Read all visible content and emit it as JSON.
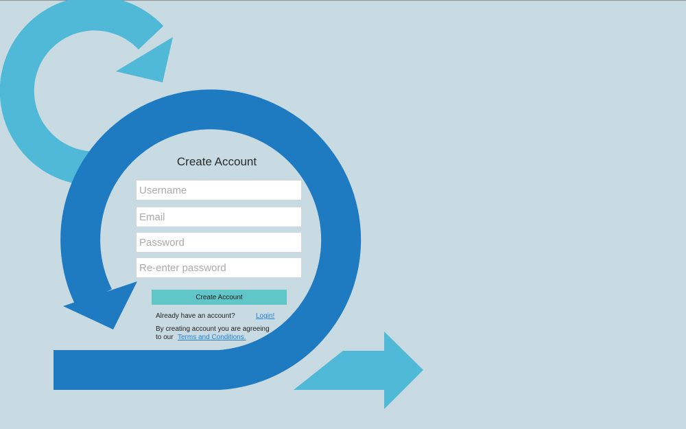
{
  "colors": {
    "background": "#c8dae2",
    "big_loop": "#1f7bc1",
    "accent_arrows": "#4fb9d7",
    "button": "#60c6c8",
    "link": "#1f7fd6"
  },
  "form": {
    "title": "Create Account",
    "fields": {
      "username_placeholder": "Username",
      "email_placeholder": "Email",
      "password_placeholder": "Password",
      "reenter_placeholder": "Re-enter password"
    },
    "submit_label": "Create Account",
    "already_text": "Already have an account?",
    "login_link": "Login!",
    "agree_line1": "By creating account you are agreeing",
    "agree_line2": "to our",
    "terms_link": "Terms and Conditions."
  }
}
